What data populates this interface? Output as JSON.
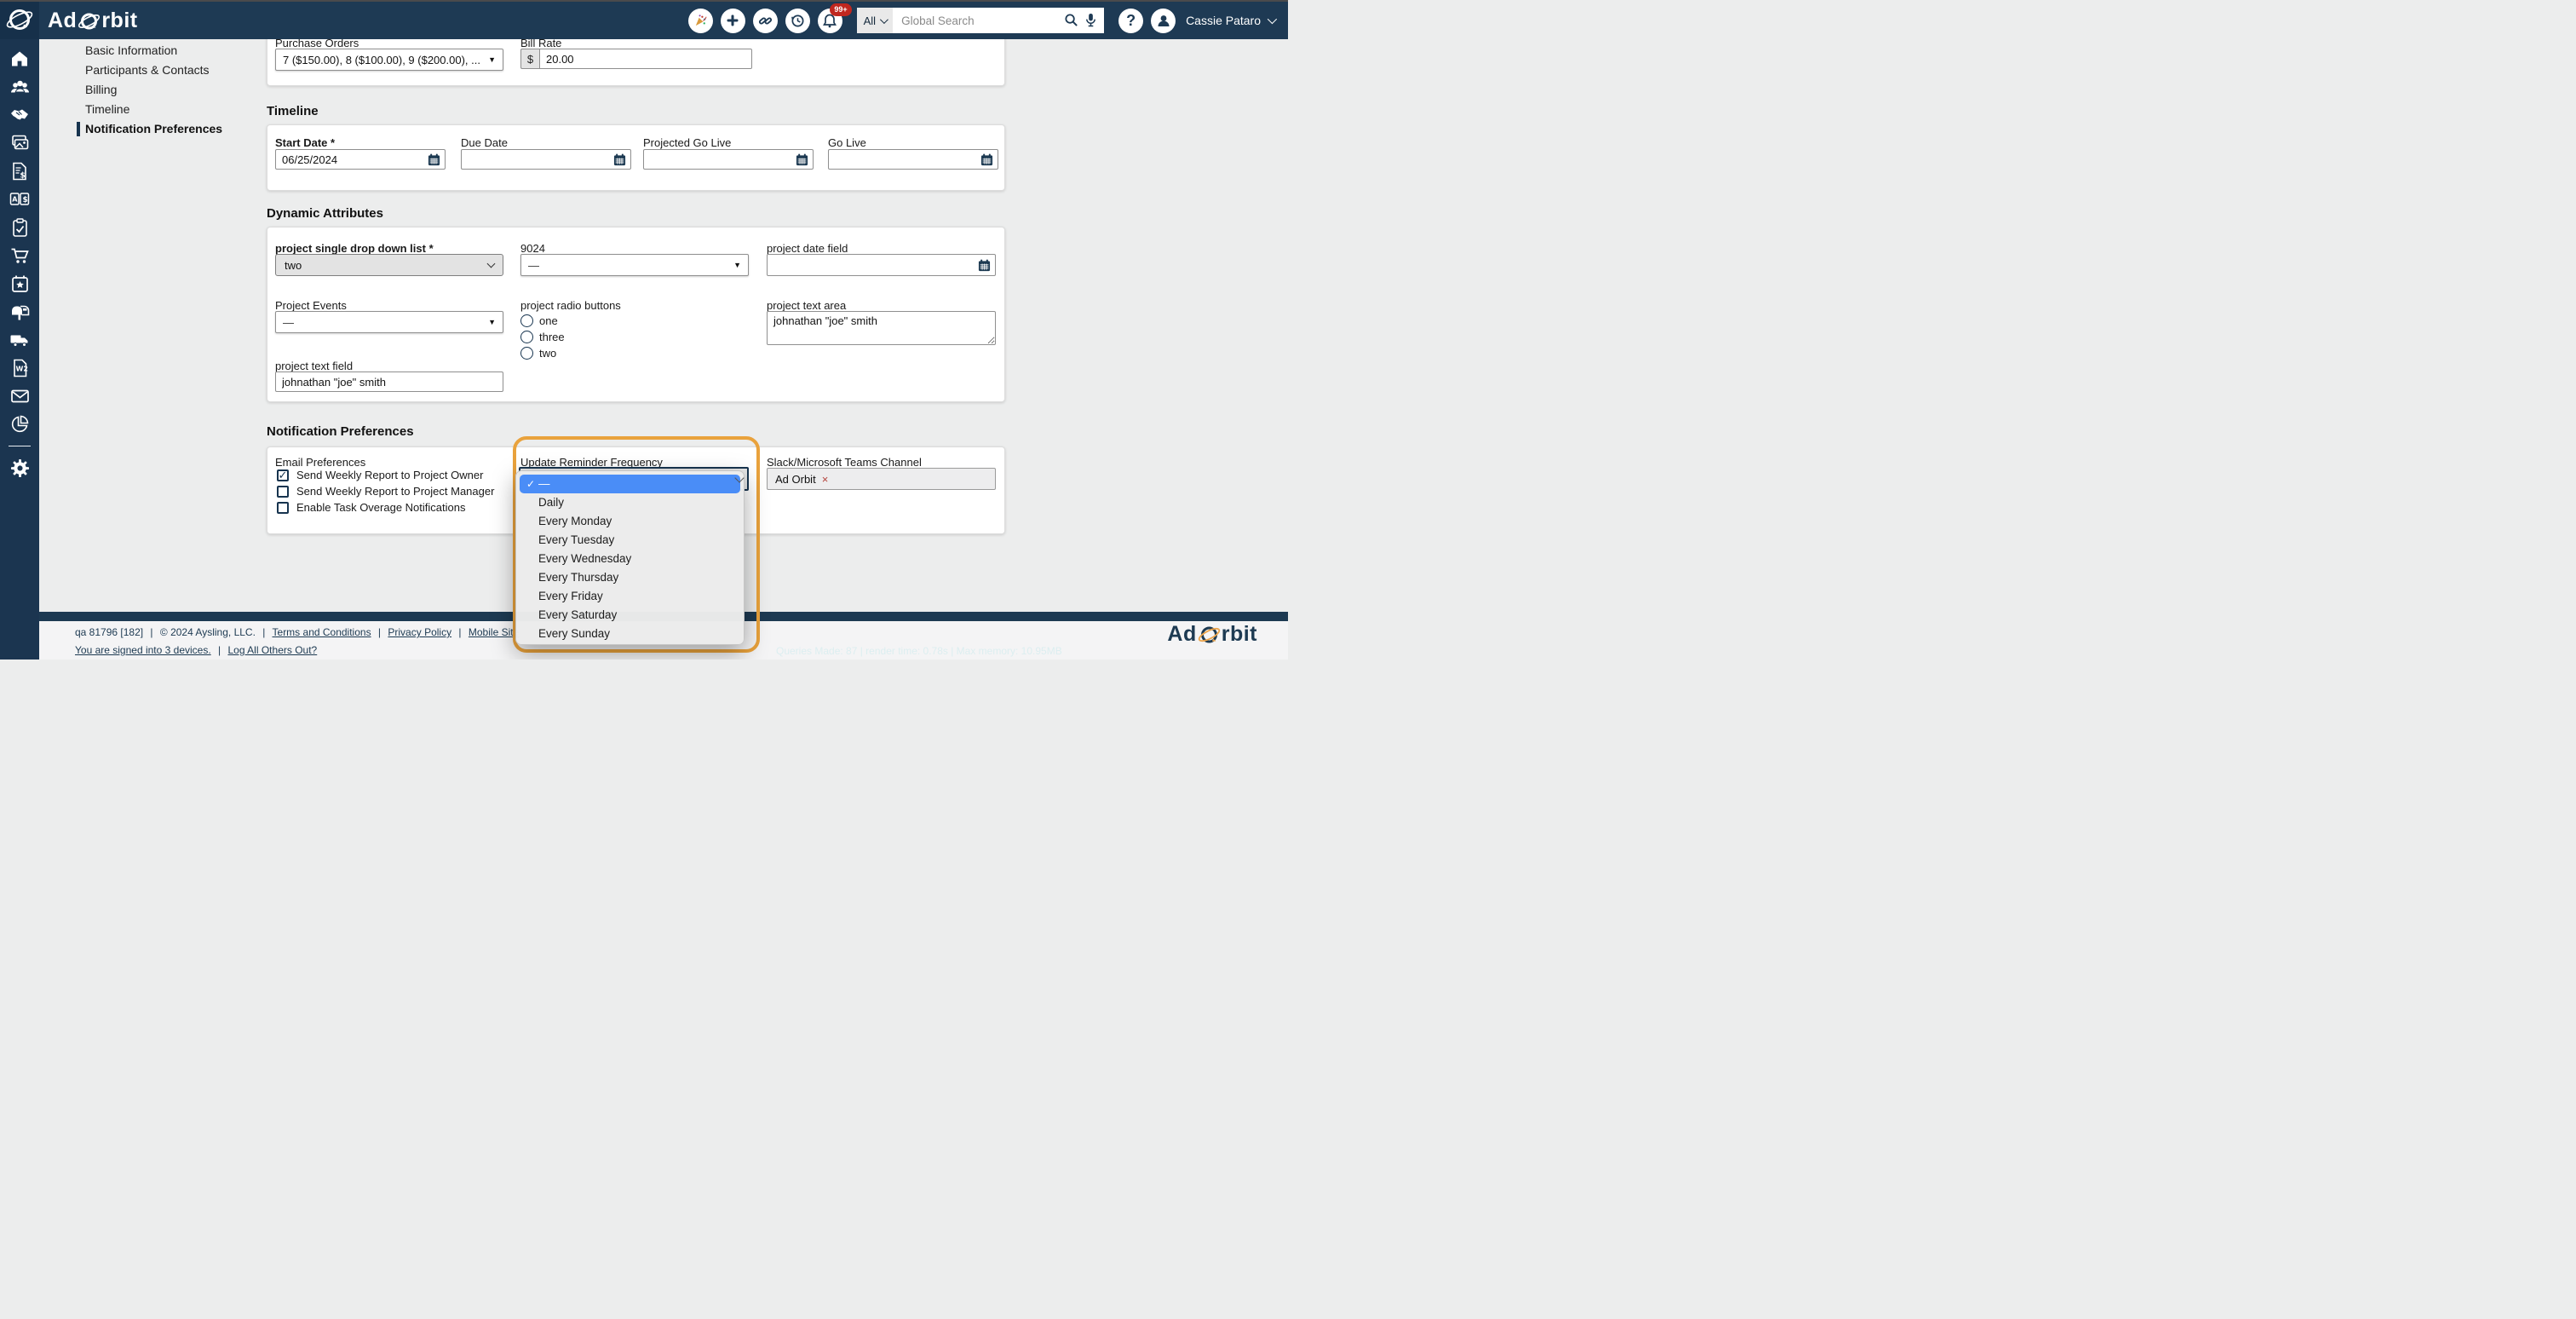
{
  "navbar": {
    "brand_ad": "Ad",
    "brand_rbit": "rbit",
    "notification_badge": "99+",
    "search_scope": "All",
    "search_placeholder": "Global Search",
    "help_glyph": "?",
    "user_name": "Cassie Pataro"
  },
  "subnav": {
    "items": [
      {
        "label": "Basic Information",
        "active": false
      },
      {
        "label": "Participants & Contacts",
        "active": false
      },
      {
        "label": "Billing",
        "active": false
      },
      {
        "label": "Timeline",
        "active": false
      },
      {
        "label": "Notification Preferences",
        "active": true
      }
    ]
  },
  "ui": {
    "dropdown_arrow": "▼",
    "check_glyph": "✓",
    "sep": "|"
  },
  "sections": {
    "purchase": {
      "po_label": "Purchase Orders",
      "po_value": "7 ($150.00), 8 ($100.00), 9 ($200.00), ...",
      "bill_rate_label": "Bill Rate",
      "currency": "$",
      "bill_rate_value": "20.00"
    },
    "timeline": {
      "title": "Timeline",
      "fields": [
        {
          "label": "Start Date *",
          "value": "06/25/2024"
        },
        {
          "label": "Due Date",
          "value": ""
        },
        {
          "label": "Projected Go Live",
          "value": ""
        },
        {
          "label": "Go Live",
          "value": ""
        }
      ]
    },
    "dynamic": {
      "title": "Dynamic Attributes",
      "dd_label": "project single drop down list *",
      "dd_value": "two",
      "num_label": "9024",
      "num_value": "—",
      "date_label": "project date field",
      "events_label": "Project Events",
      "events_value": "—",
      "radio_label": "project radio buttons",
      "radio_options": [
        "one",
        "three",
        "two"
      ],
      "textarea_label": "project text area",
      "textarea_value": "johnathan \"joe\" smith",
      "text_label": "project text field",
      "text_value": "johnathan \"joe\" smith"
    },
    "notifications": {
      "title": "Notification Preferences",
      "email_label": "Email Preferences",
      "checkboxes": [
        {
          "label": "Send Weekly Report to Project Owner",
          "checked": true,
          "glyph": "✓"
        },
        {
          "label": "Send Weekly Report to Project Manager",
          "checked": false
        },
        {
          "label": "Enable Task Overage Notifications",
          "checked": false
        }
      ],
      "frequency_label": "Update Reminder Frequency",
      "frequency_selected": "—",
      "frequency_options": [
        "—",
        "Daily",
        "Every Monday",
        "Every Tuesday",
        "Every Wednesday",
        "Every Thursday",
        "Every Friday",
        "Every Saturday",
        "Every Sunday"
      ],
      "slack_label": "Slack/Microsoft Teams Channel",
      "slack_tag": "Ad Orbit",
      "slack_remove": "×"
    }
  },
  "footer": {
    "meta": "qa 81796 [182]",
    "copyright": "© 2024 Aysling, LLC.",
    "links": [
      "Terms and Conditions",
      "Privacy Policy",
      "Mobile Site"
    ],
    "devices_link": "You are signed into 3 devices.",
    "logout_link": "Log All Others Out?",
    "stats": "Queries Made: 87 | render time: 0.78s | Max memory: 10.95MB",
    "logo_ad": "Ad",
    "logo_rbit": "rbit"
  },
  "colors": {
    "navy": "#1d3a52",
    "orange": "#e9a23c",
    "highlight_blue": "#4a8df7",
    "badge_red": "#c0271f"
  }
}
